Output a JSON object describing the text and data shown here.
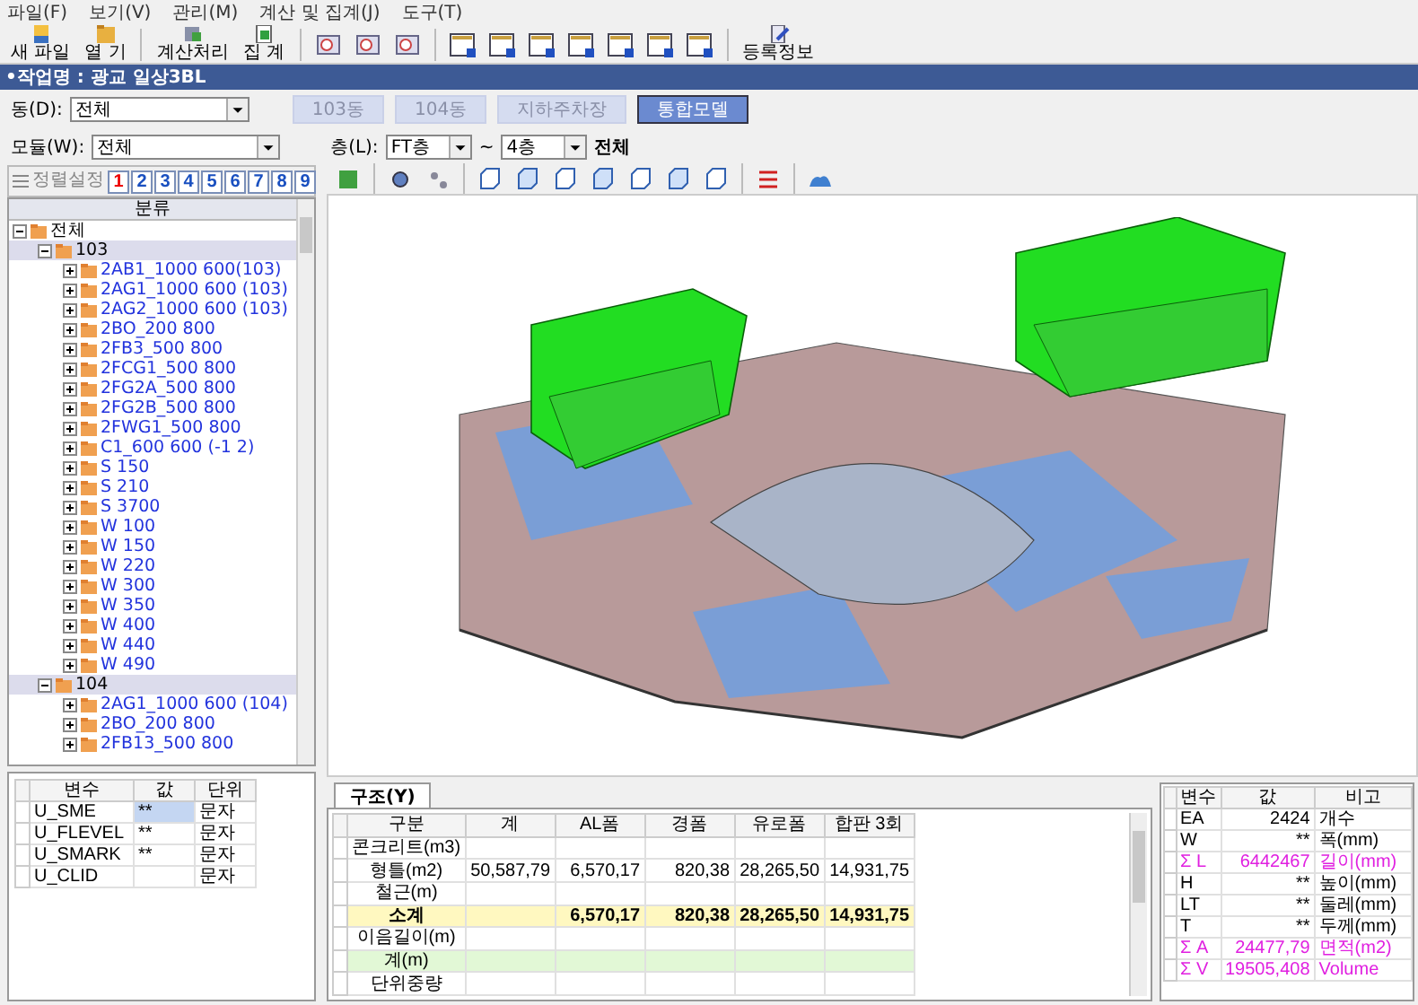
{
  "menu": [
    "파일(F)",
    "보기(V)",
    "관리(M)",
    "계산 및 집계(J)",
    "도구(T)"
  ],
  "toolbar": [
    {
      "label": "새 파일",
      "kind": "new"
    },
    {
      "label": "열 기",
      "kind": "open"
    },
    {
      "label": "계산처리",
      "kind": "calc"
    },
    {
      "label": "집 계",
      "kind": "sum"
    },
    {
      "label": "등록정보",
      "kind": "info"
    }
  ],
  "project_bar": {
    "title": "•작업명 : 광교 일상3BL"
  },
  "building": {
    "label": "동(D):",
    "value": "전체"
  },
  "tabs": [
    {
      "label": "103동",
      "selected": false
    },
    {
      "label": "104동",
      "selected": false
    },
    {
      "label": "지하주차장",
      "selected": false
    },
    {
      "label": "통합모델",
      "selected": true
    }
  ],
  "filter": {
    "module_label": "모듈(W):",
    "module_value": "전체",
    "floor_label": "층(L):",
    "floor_from": "FT층",
    "tilde": "~",
    "floor_to": "4층",
    "scope": "전체"
  },
  "sort_button": {
    "label": "정렬설정",
    "disabled": true
  },
  "number_buttons": [
    {
      "label": "1",
      "selected": true
    },
    {
      "label": "2",
      "selected": false
    },
    {
      "label": "3",
      "selected": false
    },
    {
      "label": "4",
      "selected": false
    },
    {
      "label": "5",
      "selected": false
    },
    {
      "label": "6",
      "selected": false
    },
    {
      "label": "7",
      "selected": false
    },
    {
      "label": "8",
      "selected": false
    },
    {
      "label": "9",
      "selected": false
    }
  ],
  "tree": {
    "header": "분류",
    "items": [
      {
        "label": "전체",
        "expanded": true,
        "children": [
          {
            "label": "103",
            "expanded": true,
            "children": [
              {
                "label": "2AB1_1000 600(103)",
                "expanded": false
              },
              {
                "label": "2AG1_1000 600 (103)",
                "expanded": false
              },
              {
                "label": "2AG2_1000 600 (103)",
                "expanded": false
              },
              {
                "label": "2BO_200 800",
                "expanded": false
              },
              {
                "label": "2FB3_500 800",
                "expanded": false
              },
              {
                "label": "2FCG1_500 800",
                "expanded": false
              },
              {
                "label": "2FG2A_500 800",
                "expanded": false
              },
              {
                "label": "2FG2B_500 800",
                "expanded": false
              },
              {
                "label": "2FWG1_500 800",
                "expanded": false
              },
              {
                "label": "C1_600 600 (-1 2)",
                "expanded": false
              },
              {
                "label": "S 150",
                "expanded": false
              },
              {
                "label": "S 210",
                "expanded": false
              },
              {
                "label": "S 3700",
                "expanded": false
              },
              {
                "label": "W 100",
                "expanded": false
              },
              {
                "label": "W 150",
                "expanded": false
              },
              {
                "label": "W 220",
                "expanded": false
              },
              {
                "label": "W 300",
                "expanded": false
              },
              {
                "label": "W 350",
                "expanded": false
              },
              {
                "label": "W 400",
                "expanded": false
              },
              {
                "label": "W 440",
                "expanded": false
              },
              {
                "label": "W 490",
                "expanded": false
              }
            ]
          },
          {
            "label": "104",
            "expanded": true,
            "children": [
              {
                "label": "2AG1_1000 600 (104)",
                "expanded": false
              },
              {
                "label": "2BO_200 800",
                "expanded": false
              },
              {
                "label": "2FB13_500 800",
                "expanded": false
              }
            ]
          }
        ]
      }
    ]
  },
  "variables": {
    "columns": [
      "변수",
      "값",
      "단위"
    ],
    "rows": [
      {
        "name": "U_SME",
        "value": "**",
        "unit": "문자",
        "selected": true
      },
      {
        "name": "U_FLEVEL",
        "value": "**",
        "unit": "문자",
        "selected": false
      },
      {
        "name": "U_SMARK",
        "value": "**",
        "unit": "문자",
        "selected": false
      },
      {
        "name": "U_CLID",
        "value": null,
        "unit": "문자",
        "selected": false
      }
    ]
  },
  "quantity": {
    "tab": "구조(Y)",
    "columns": [
      "구분",
      "계",
      "AL폼",
      "경폼",
      "유로폼",
      "합판 3회"
    ],
    "rows": [
      {
        "kind": "normal",
        "cells": [
          "콘크리트(m3)",
          null,
          null,
          null,
          null,
          null
        ]
      },
      {
        "kind": "normal",
        "cells": [
          "형틀(m2)",
          "50,587,79",
          "6,570,17",
          "820,38",
          "28,265,50",
          "14,931,75"
        ]
      },
      {
        "kind": "normal",
        "cells": [
          "철근(m)",
          null,
          null,
          null,
          null,
          null
        ]
      },
      {
        "kind": "subtotal",
        "cells": [
          "소계",
          null,
          "6,570,17",
          "820,38",
          "28,265,50",
          "14,931,75"
        ]
      },
      {
        "kind": "normal",
        "cells": [
          "이음길이(m)",
          null,
          null,
          null,
          null,
          null
        ]
      },
      {
        "kind": "total",
        "cells": [
          "계(m)",
          null,
          null,
          null,
          null,
          null
        ]
      },
      {
        "kind": "normal",
        "cells": [
          "단위중량",
          null,
          null,
          null,
          null,
          null
        ]
      }
    ]
  },
  "properties": {
    "columns": [
      "변수",
      "값",
      "비고"
    ],
    "rows": [
      {
        "name": "EA",
        "value": "2424",
        "note": "개수",
        "highlight": false
      },
      {
        "name": "W",
        "value": "**",
        "note": "폭(mm)",
        "highlight": false
      },
      {
        "name": "Σ L",
        "value": "6442467",
        "note": "길이(mm)",
        "highlight": true
      },
      {
        "name": "H",
        "value": "**",
        "note": "높이(mm)",
        "highlight": false
      },
      {
        "name": "LT",
        "value": "**",
        "note": "둘레(mm)",
        "highlight": false
      },
      {
        "name": "T",
        "value": "**",
        "note": "두께(mm)",
        "highlight": false
      },
      {
        "name": "Σ A",
        "value": "24477,79",
        "note": "면적(m2)",
        "highlight": true
      },
      {
        "name": "Σ V",
        "value": "19505,408",
        "note": "Volume",
        "highlight": true
      }
    ]
  }
}
